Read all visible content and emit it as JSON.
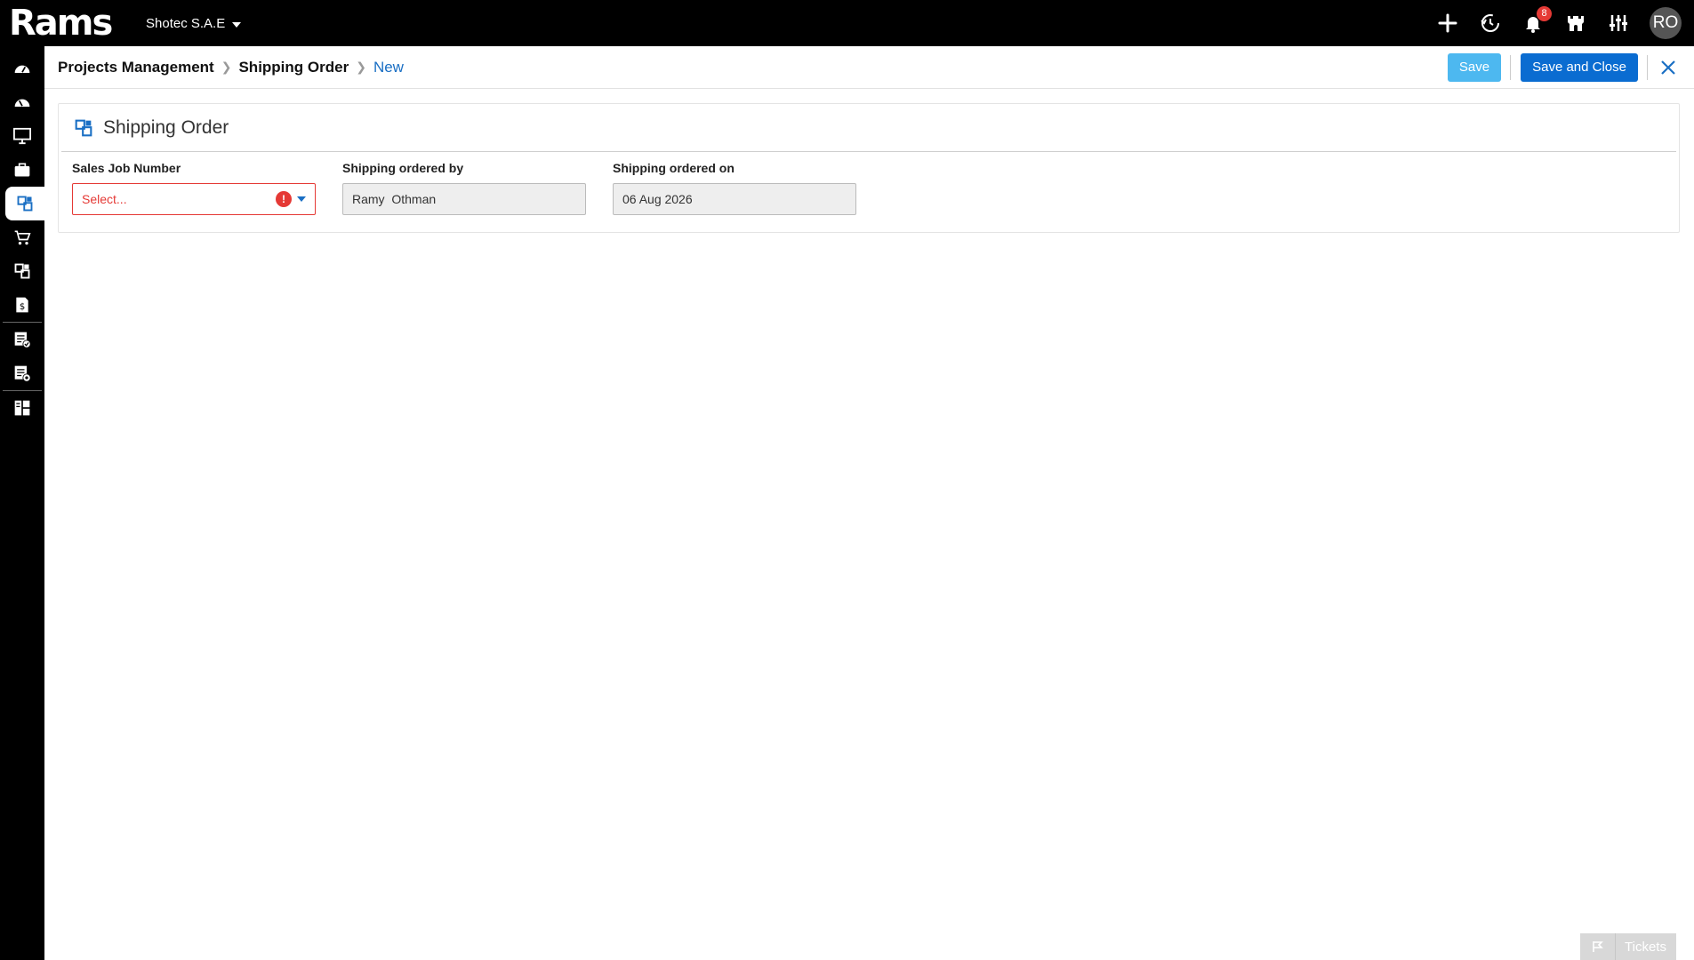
{
  "app": {
    "logo_text": "Rams",
    "company": "Shotec S.A.E"
  },
  "topbar": {
    "notifications_count": "8",
    "user_initials": "RO"
  },
  "breadcrumb": {
    "items": [
      "Projects Management",
      "Shipping Order",
      "New"
    ]
  },
  "actions": {
    "save_label": "Save",
    "save_close_label": "Save and Close"
  },
  "form": {
    "title": "Shipping Order",
    "fields": {
      "sales_job_number": {
        "label": "Sales Job Number",
        "placeholder": "Select...",
        "error_icon": "!"
      },
      "shipping_ordered_by": {
        "label": "Shipping ordered by",
        "value": "Ramy  Othman"
      },
      "shipping_ordered_on": {
        "label": "Shipping ordered on",
        "value": "06 Aug 2026"
      }
    }
  },
  "footer": {
    "tickets_label": "Tickets"
  },
  "colors": {
    "accent": "#0a6cd1",
    "save_button": "#4db8f0",
    "error": "#e53935",
    "badge": "#e53935",
    "topbar": "#000000"
  },
  "icons": {
    "sidebar": [
      "dashboard-icon",
      "dashboard-alt-icon",
      "monitor-icon",
      "briefcase-icon",
      "shipping-order-icon",
      "cart-icon",
      "modules-icon",
      "invoice-icon",
      "checklist-icon",
      "report-settings-icon",
      "widgets-icon"
    ],
    "topbar": [
      "plus-icon",
      "history-icon",
      "bell-icon",
      "castle-icon",
      "sliders-icon"
    ]
  }
}
